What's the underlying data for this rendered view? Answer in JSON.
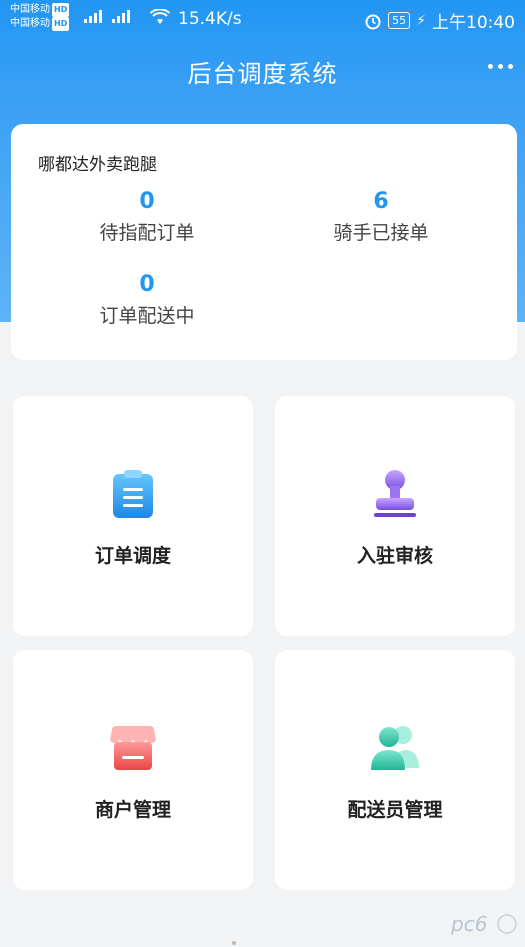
{
  "status_bar": {
    "carrier1": "中国移动",
    "carrier2": "中国移动",
    "hd": "HD",
    "net_type": "4G",
    "speed": "15.4K/s",
    "battery": "55",
    "time": "上午10:40"
  },
  "header": {
    "title": "后台调度系统"
  },
  "summary": {
    "company": "哪都达外卖跑腿",
    "stats": [
      {
        "value": "0",
        "label": "待指配订单"
      },
      {
        "value": "6",
        "label": "骑手已接单"
      },
      {
        "value": "0",
        "label": "订单配送中"
      }
    ]
  },
  "tiles": [
    {
      "label": "订单调度",
      "icon": "clipboard-icon"
    },
    {
      "label": "入驻审核",
      "icon": "stamp-icon"
    },
    {
      "label": "商户管理",
      "icon": "store-icon"
    },
    {
      "label": "配送员管理",
      "icon": "users-icon"
    }
  ],
  "colors": {
    "primary": "#2196f3",
    "header_gradient_end": "#5fb3f7",
    "background": "#f2f3f5"
  }
}
